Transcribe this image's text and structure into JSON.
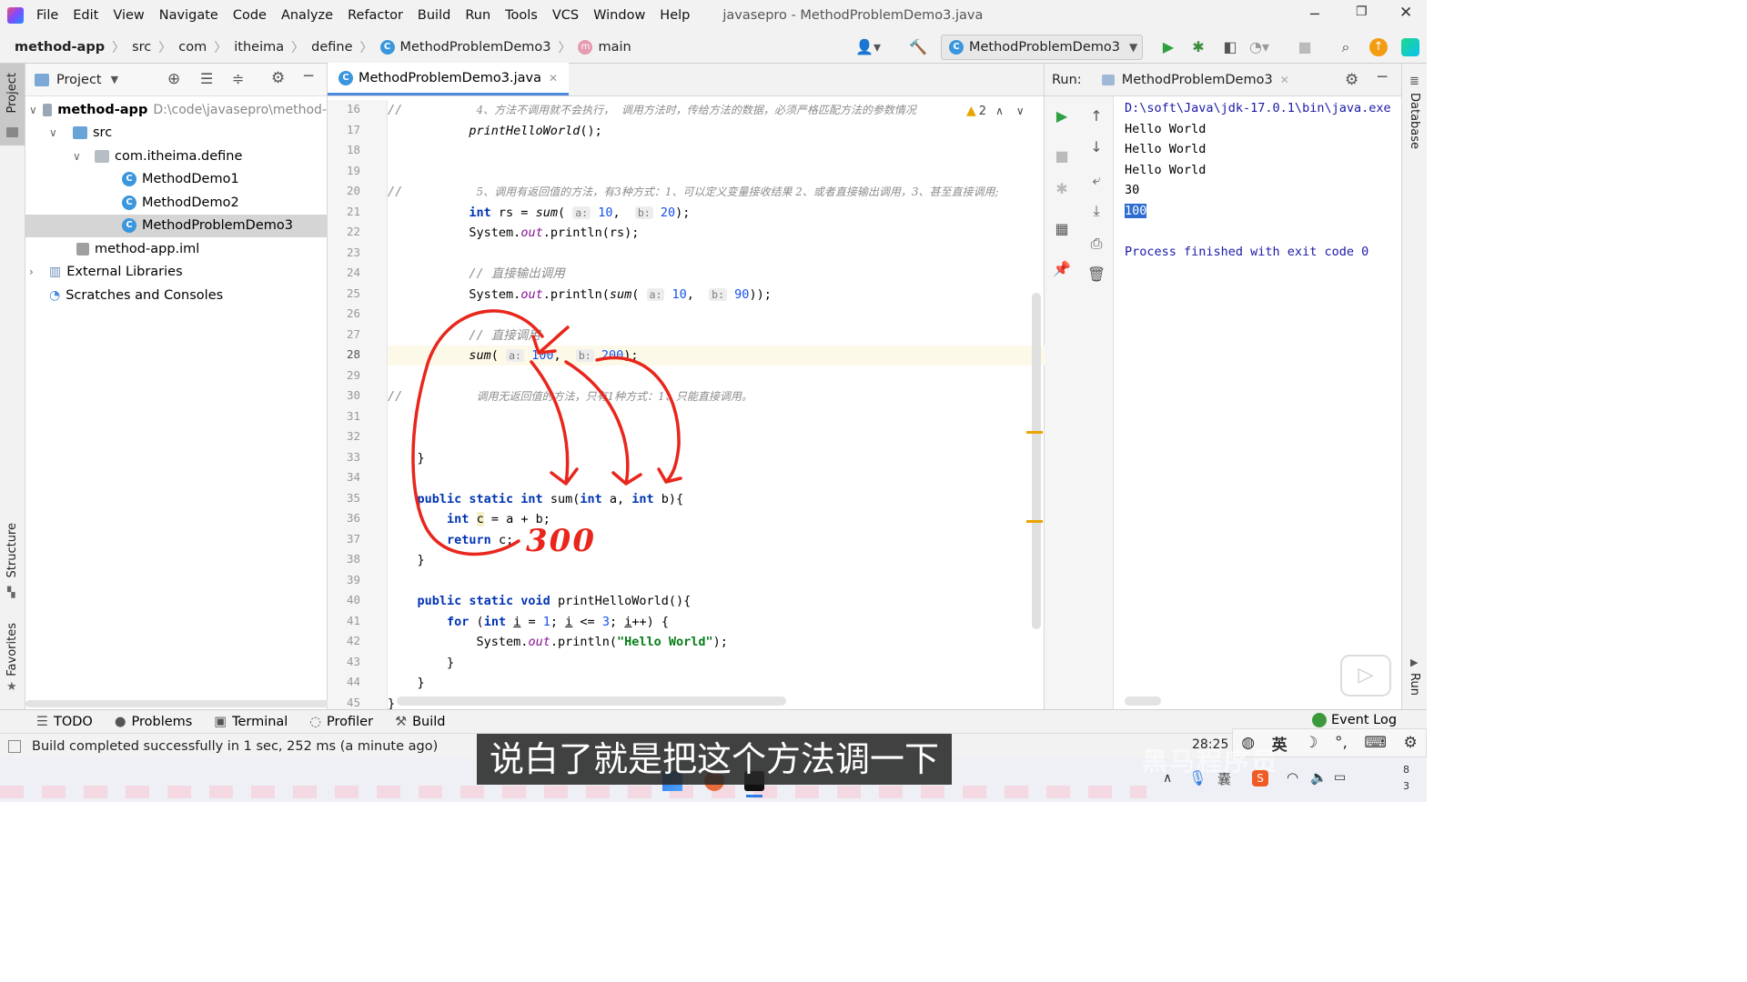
{
  "menubar": {
    "items": [
      "File",
      "Edit",
      "View",
      "Navigate",
      "Code",
      "Analyze",
      "Refactor",
      "Build",
      "Run",
      "Tools",
      "VCS",
      "Window",
      "Help"
    ],
    "window_title": "javasepro - MethodProblemDemo3.java"
  },
  "navbar": {
    "breadcrumbs": [
      "method-app",
      "src",
      "com",
      "itheima",
      "define",
      "MethodProblemDemo3",
      "main"
    ],
    "run_config": "MethodProblemDemo3"
  },
  "project": {
    "title": "Project",
    "tree": [
      {
        "label": "method-app",
        "path": "D:\\code\\javasepro\\method-",
        "kind": "module"
      },
      {
        "label": "src",
        "kind": "folder"
      },
      {
        "label": "com.itheima.define",
        "kind": "package"
      },
      {
        "label": "MethodDemo1",
        "kind": "class"
      },
      {
        "label": "MethodDemo2",
        "kind": "class"
      },
      {
        "label": "MethodProblemDemo3",
        "kind": "class",
        "selected": true
      },
      {
        "label": "method-app.iml",
        "kind": "file"
      },
      {
        "label": "External Libraries",
        "kind": "lib"
      },
      {
        "label": "Scratches and Consoles",
        "kind": "scratch"
      }
    ]
  },
  "left_strip": {
    "project": "Project",
    "structure": "Structure",
    "favorites": "Favorites"
  },
  "right_strip": {
    "database": "Database",
    "run": "Run"
  },
  "editor": {
    "tab": "MethodProblemDemo3.java",
    "warning_count": "2",
    "line_numbers": [
      "16",
      "17",
      "18",
      "19",
      "20",
      "21",
      "22",
      "23",
      "24",
      "25",
      "26",
      "27",
      "28",
      "29",
      "30",
      "31",
      "32",
      "33",
      "34",
      "35",
      "36",
      "37",
      "38",
      "39",
      "40",
      "41",
      "42",
      "43",
      "44",
      "45"
    ],
    "comment_16": "4、方法不调用就不会执行，  调用方法时，传给方法的数据，必须严格匹配方法的参数情况",
    "comment_20": "5、调用有返回值的方法，有3种方式：1、可以定义变量接收结果 2、或者直接输出调用，3、甚至直接调用;",
    "comment_24": "// 直接输出调用",
    "comment_27": "// 直接调用",
    "comment_30": "调用无返回值的方法，只有1种方式：1、只能直接调用。",
    "handwriting": "300"
  },
  "run": {
    "label": "Run:",
    "tab": "MethodProblemDemo3",
    "console": [
      "D:\\soft\\Java\\jdk-17.0.1\\bin\\java.exe",
      "Hello World",
      "Hello World",
      "Hello World",
      "30",
      "100",
      "",
      "Process finished with exit code 0"
    ]
  },
  "bottom_tabs": [
    "TODO",
    "Problems",
    "Terminal",
    "Profiler",
    "Build"
  ],
  "event_log": "Event Log",
  "status": {
    "message": "Build completed successfully in 1 sec, 252 ms (a minute ago)",
    "time": "28:25",
    "ime": "英",
    "clock_lines": [
      "8",
      "3"
    ]
  },
  "subtitle": "说白了就是把这个方法调一下",
  "watermark": "黑马程序员",
  "colors": {
    "accent": "#4a89dc",
    "run_green": "#2ea043",
    "annotation_red": "#e8261c"
  }
}
